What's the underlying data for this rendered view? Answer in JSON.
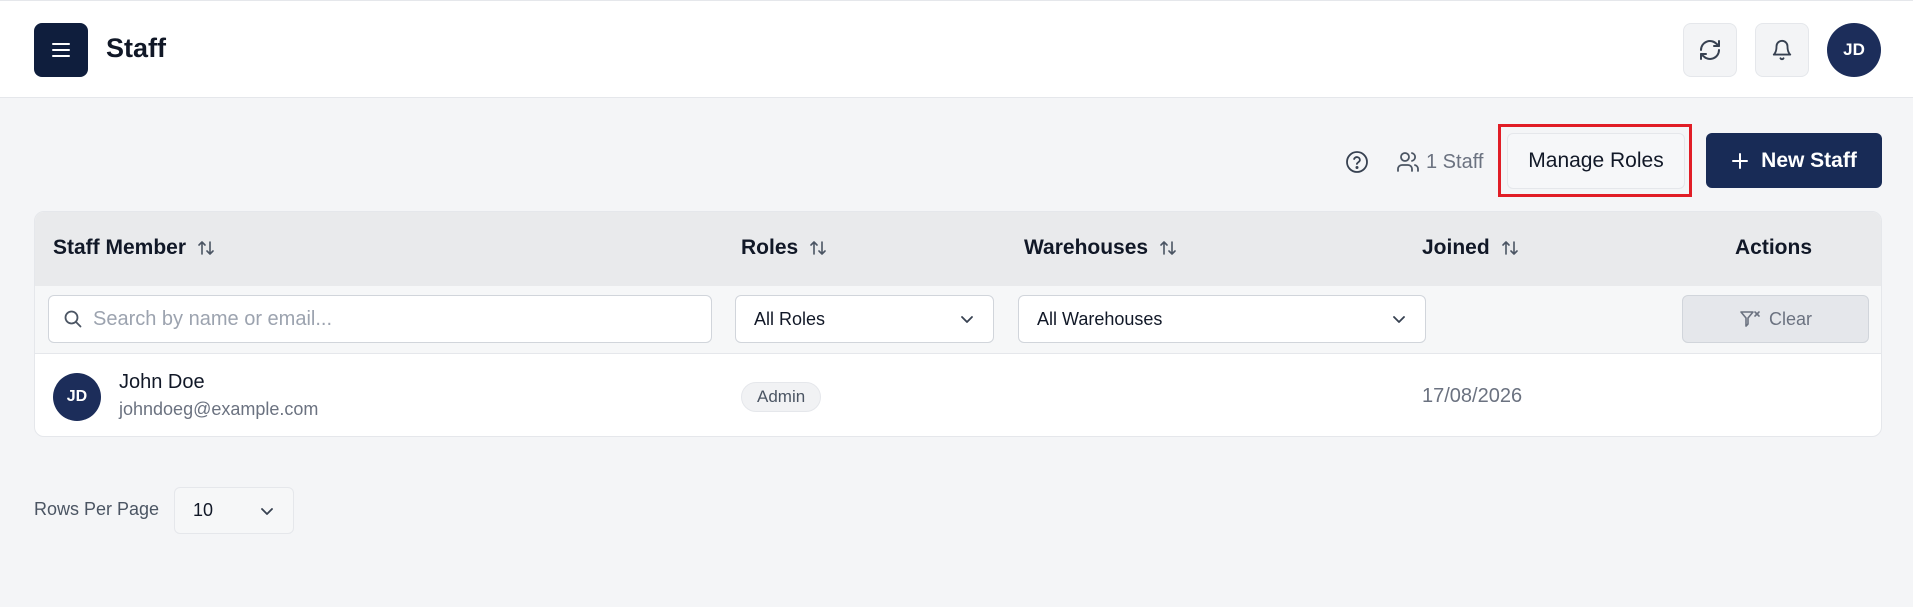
{
  "header": {
    "title": "Staff",
    "avatar_initials": "JD"
  },
  "toolbar": {
    "staff_count": "1 Staff",
    "manage_roles_label": "Manage Roles",
    "new_staff_label": "New Staff"
  },
  "table": {
    "columns": [
      {
        "label": "Staff Member",
        "sortable": true
      },
      {
        "label": "Roles",
        "sortable": true
      },
      {
        "label": "Warehouses",
        "sortable": true
      },
      {
        "label": "Joined",
        "sortable": true
      },
      {
        "label": "Actions",
        "sortable": false
      }
    ],
    "filters": {
      "search_placeholder": "Search by name or email...",
      "search_value": "",
      "roles_selected": "All Roles",
      "warehouses_selected": "All Warehouses",
      "clear_label": "Clear"
    },
    "rows": [
      {
        "initials": "JD",
        "name": "John Doe",
        "email": "johndoeg@example.com",
        "role": "Admin",
        "warehouses": "",
        "joined": "17/08/2026"
      }
    ]
  },
  "pagination": {
    "rows_per_page_label": "Rows Per Page",
    "rows_per_page_value": "10"
  },
  "colors": {
    "primary": "#182b56",
    "highlight": "#e11d26",
    "header_bg": "#e9eaec",
    "page_bg": "#f4f5f7"
  },
  "icons": [
    "menu-icon",
    "refresh-icon",
    "bell-icon",
    "help-icon",
    "users-icon",
    "plus-icon",
    "sort-icon",
    "search-icon",
    "chevron-down-icon",
    "filter-clear-icon"
  ]
}
